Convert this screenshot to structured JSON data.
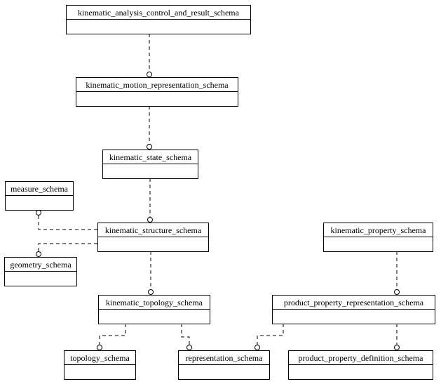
{
  "diagram": {
    "notation": "EXPRESS-G schema-level diagram",
    "schemas": [
      {
        "id": "kacr",
        "name": "kinematic_analysis_control_and_result_schema"
      },
      {
        "id": "kmr",
        "name": "kinematic_motion_representation_schema"
      },
      {
        "id": "ks",
        "name": "kinematic_state_schema"
      },
      {
        "id": "ms",
        "name": "measure_schema"
      },
      {
        "id": "kst",
        "name": "kinematic_structure_schema"
      },
      {
        "id": "gs",
        "name": "geometry_schema"
      },
      {
        "id": "kt",
        "name": "kinematic_topology_schema"
      },
      {
        "id": "kp",
        "name": "kinematic_property_schema"
      },
      {
        "id": "ppr",
        "name": "product_property_representation_schema"
      },
      {
        "id": "ts",
        "name": "topology_schema"
      },
      {
        "id": "rs",
        "name": "representation_schema"
      },
      {
        "id": "ppd",
        "name": "product_property_definition_schema"
      }
    ],
    "references": [
      {
        "from": "kacr",
        "to": "kmr",
        "style": "dashed"
      },
      {
        "from": "kmr",
        "to": "ks",
        "style": "dashed"
      },
      {
        "from": "ks",
        "to": "kst",
        "style": "dashed"
      },
      {
        "from": "kst",
        "to": "ms",
        "style": "dashed"
      },
      {
        "from": "kst",
        "to": "gs",
        "style": "dashed"
      },
      {
        "from": "kst",
        "to": "kt",
        "style": "dashed"
      },
      {
        "from": "kt",
        "to": "ts",
        "style": "dashed"
      },
      {
        "from": "kt",
        "to": "rs",
        "style": "dashed"
      },
      {
        "from": "kp",
        "to": "ppr",
        "style": "dashed"
      },
      {
        "from": "ppr",
        "to": "rs",
        "style": "dashed"
      },
      {
        "from": "ppr",
        "to": "ppd",
        "style": "dashed"
      }
    ]
  }
}
